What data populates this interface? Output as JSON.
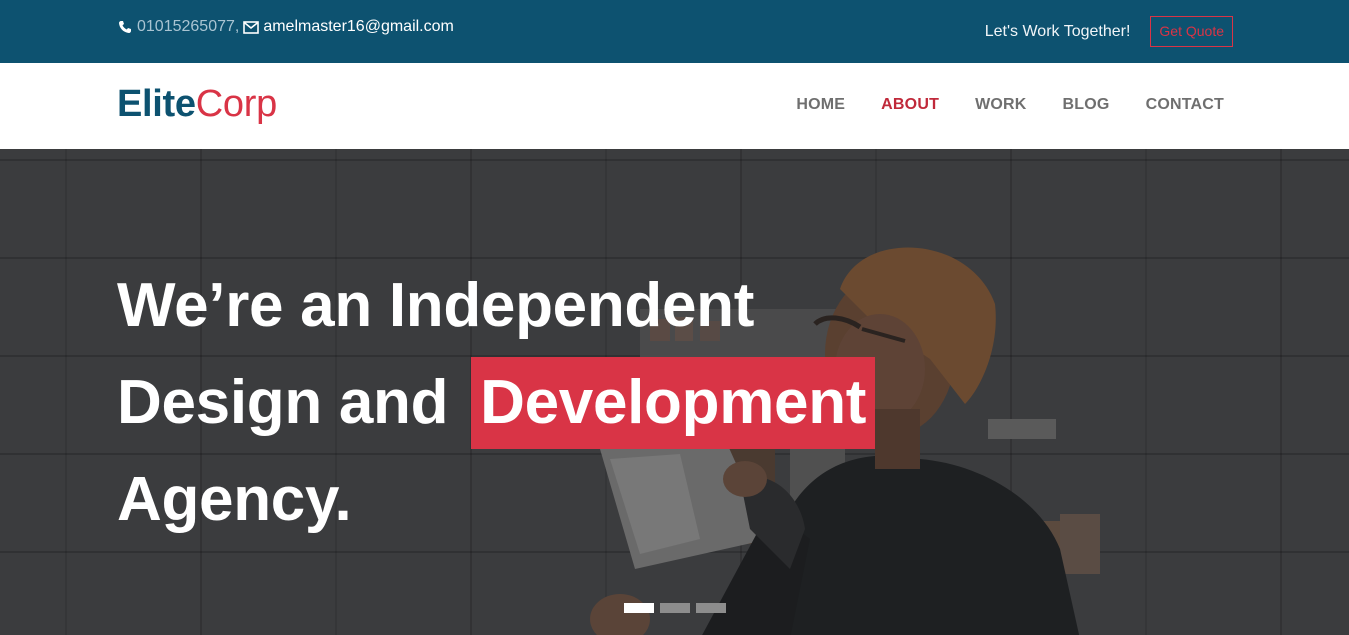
{
  "topbar": {
    "phone": "01015265077,",
    "email": "amelmaster16@gmail.com",
    "phone_icon": "phone-icon",
    "email_icon": "envelope-icon",
    "tagline": "Let's Work Together!",
    "quote_button": "Get Quote"
  },
  "brand": {
    "part1": "Elite",
    "part2": "Corp"
  },
  "nav": {
    "items": [
      "HOME",
      "ABOUT",
      "WORK",
      "BLOG",
      "CONTACT"
    ],
    "active": "ABOUT"
  },
  "hero": {
    "line1": "We’re an Independent",
    "line2_prefix": "Design and",
    "line2_highlight": "Development",
    "line3": "Agency.",
    "slides": {
      "count": 3,
      "active": 1
    }
  },
  "colors": {
    "primary": "#0d5270",
    "accent": "#d93446",
    "nav_text": "#6f6f6f"
  }
}
